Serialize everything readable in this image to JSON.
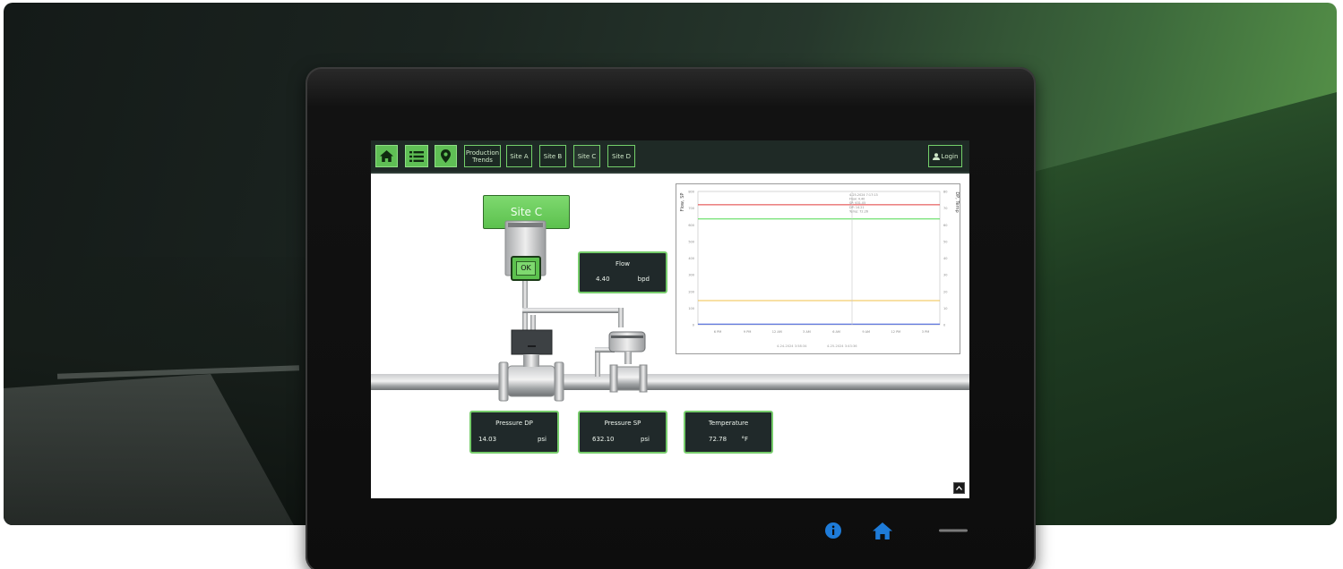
{
  "topbar": {
    "nav": [
      {
        "type": "icon",
        "icon": "home-icon"
      },
      {
        "type": "icon",
        "icon": "list-icon"
      },
      {
        "type": "icon",
        "icon": "map-pin-icon"
      },
      {
        "type": "text",
        "label_line1": "Production",
        "label_line2": "Trends"
      },
      {
        "type": "text",
        "label": "Site A"
      },
      {
        "type": "text",
        "label": "Site B"
      },
      {
        "type": "text",
        "label": "Site C",
        "active": true
      },
      {
        "type": "text",
        "label": "Site D"
      }
    ],
    "login_label": "Login"
  },
  "site_title": "Site C",
  "transmitter_status": "OK",
  "flow": {
    "title": "Flow",
    "value": "4.40",
    "unit": "bpd"
  },
  "pressure_dp": {
    "title": "Pressure DP",
    "value": "14.03",
    "unit": "psi"
  },
  "pressure_sp": {
    "title": "Pressure SP",
    "value": "632.10",
    "unit": "psi"
  },
  "temperature": {
    "title": "Temperature",
    "value": "72.78",
    "unit": "°F"
  },
  "colors": {
    "accent": "#74d06a",
    "panel": "#20292a",
    "topbar": "#1f2a26",
    "device_icons": "#1e7bd8"
  },
  "chart_data": {
    "type": "line",
    "ylabel_left": "Flow, SP",
    "ylabel_right": "DP, Temp",
    "ylim_left": [
      0,
      800
    ],
    "ylim_right": [
      0,
      80
    ],
    "yticks_left": [
      "0",
      "100",
      "200",
      "300",
      "400",
      "500",
      "600",
      "700",
      "800"
    ],
    "yticks_right": [
      "0",
      "10",
      "20",
      "30",
      "40",
      "50",
      "60",
      "70",
      "80"
    ],
    "xticks": [
      "6 PM",
      "9 PM",
      "12 AM",
      "3 AM",
      "6 AM",
      "9 AM",
      "12 PM",
      "3 PM"
    ],
    "tooltip": [
      "4-25-2024 7:17:13",
      "Flow: 4.40",
      "SP: 631.05",
      "DP: 14.21",
      "Temp: 72.26"
    ],
    "range_start": "4-24-2024 3:58:34",
    "range_end": "4-25-2024 3:43:36",
    "grid": false,
    "series": [
      {
        "axis": "left",
        "color": "#e03b3b",
        "values": [
          720,
          720,
          720,
          720,
          720,
          720,
          720,
          720
        ]
      },
      {
        "axis": "right",
        "color": "#4fd94f",
        "values": [
          63.5,
          63.5,
          63.5,
          63.5,
          63.5,
          63.5,
          63.5,
          63.5
        ]
      },
      {
        "axis": "right",
        "color": "#f2c04a",
        "values": [
          14.5,
          14.5,
          14.5,
          14.5,
          14.5,
          14.5,
          14.5,
          14.5
        ]
      },
      {
        "axis": "left",
        "color": "#3e5de0",
        "values": [
          4.4,
          4.4,
          4.4,
          4.4,
          4.4,
          4.4,
          4.4,
          4.4
        ]
      }
    ]
  }
}
